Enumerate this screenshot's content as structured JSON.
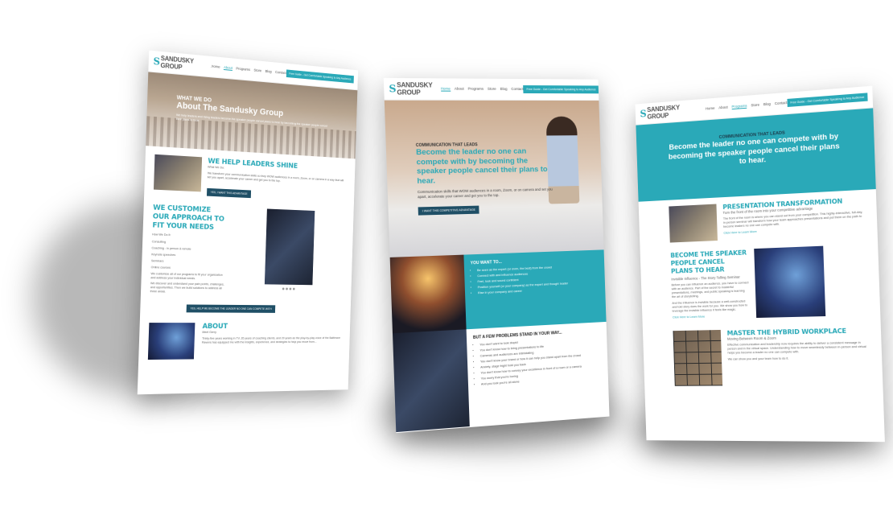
{
  "brand": {
    "name": "SANDUSKY GROUP",
    "accent": "#2aa9b8",
    "dark_button": "#1f4f66"
  },
  "nav": {
    "items": [
      "Home",
      "About",
      "Programs",
      "Store",
      "Blog",
      "Contact"
    ],
    "cta": "Free Guide - Get Comfortable Speaking to Any Audience"
  },
  "left": {
    "kicker": "WHAT WE DO",
    "title": "About The Sandusky Group",
    "intro": "We help leaders and rising leaders become the speaker people cancel plans to hear by becoming the speaker people cancel their plans to hear.",
    "s1_heading": "WE HELP LEADERS SHINE",
    "s1_sub": "What We Do:",
    "s1_body": "We transform your communication skills so they WOW audiences in a room, Zoom, or on camera in a way that will set you apart, accelerate your career and get you to the top.",
    "s1_button": "YES, I WANT THIS ADVANTAGE",
    "s2_heading": "WE CUSTOMIZE OUR APPROACH TO FIT YOUR NEEDS",
    "s2_sub": "How We Do It:",
    "s2_list": [
      "Consulting",
      "Coaching - in person & remote",
      "Keynote speeches",
      "Seminars",
      "Online courses"
    ],
    "s2_body": "We customize all of our programs to fit your organization and address your individual needs.",
    "s2_body2": "We discover and understand your pain points, challenges, and opportunities. Then we build solutions to address all three areas.",
    "s2_button": "YES, HELP ME BECOME THE LEADER NO ONE CAN COMPETE WITH",
    "s3_heading": "ABOUT",
    "s3_sub": "Meet Gerry",
    "s3_body": "Thirty-five years working in TV, 35 years of coaching clients, and 20 years as the play-by-play voice of the Baltimore Ravens has equipped me with the insights, experience, and strategies to help you move from..."
  },
  "mid": {
    "kicker": "COMMUNICATION THAT LEADS",
    "title": "Become the leader no one can compete with by becoming the speaker people cancel their plans to hear.",
    "body": "Communication skills that WOW audiences in a room, Zoom, or on camera and set you apart, accelerate your career and get you to the top.",
    "button": "I WANT THIS COMPETITIVE ADVANTAGE",
    "want_heading": "YOU WANT TO...",
    "want_list": [
      "Be seen as the expert (or even, the best) from the crowd",
      "Connect with and influence audiences",
      "Feel, look and sound confident",
      "Position yourself (or your company) as the expert and thought leader",
      "Rise in your company and career"
    ],
    "problems_heading": "BUT A FEW PROBLEMS STAND IN YOUR WAY...",
    "problems_list": [
      "You don't want to look stupid",
      "You don't know how to bring presentations to life",
      "Cameras and audiences are intimidating",
      "You don't know your brand or how it can help you stand apart from the crowd",
      "Anxiety, stage fright hold you back",
      "You don't know how to convey your excellence in front of a room or a camera",
      "You worry that you're boring",
      "And you look you're all alone"
    ]
  },
  "right": {
    "kicker": "COMMUNICATION THAT LEADS",
    "title": "Become the leader no one can compete with by becoming the speaker people cancel their plans to hear.",
    "s1_heading": "PRESENTATION TRANSFORMATION",
    "s1_sub": "Turn the front of the room into your competitive advantage",
    "s1_body": "The front of the room is where you can stand out from your competition. This highly-interactive, full-day, in-person seminar will transform how your team approaches presentations and put them on the path to become leaders no one can compete with.",
    "s1_link": "Click Here to Learn More",
    "s2_heading": "BECOME THE SPEAKER PEOPLE CANCEL PLANS TO HEAR",
    "s2_sub": "Invisible Influence - The Story Telling Seminar",
    "s2_body": "Before you can influence an audience, you have to connect with an audience. Part of the secret to masterful presentations, meetings, and public speaking is learning the art of storytelling.",
    "s2_body2": "And the influence is invisible because a well-constructed and told story does the work for you. We show you how to leverage the invisible influence it feels like magic.",
    "s2_link": "Click Here to Learn More",
    "s3_heading": "MASTER THE HYBRID WORKPLACE",
    "s3_sub": "Moving Between Room & Zoom",
    "s3_body": "Effective communication and leadership now requires the ability to deliver a consistent message in person and in the virtual space. Understanding how to move seamlessly between in-person and virtual helps you become a leader no one can compete with.",
    "s3_body2": "We can show you and your team how to do it."
  }
}
